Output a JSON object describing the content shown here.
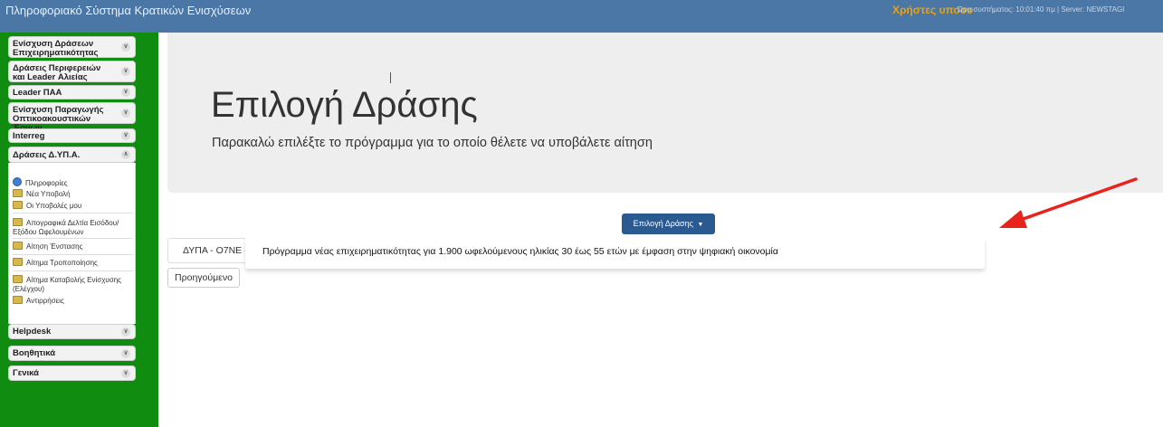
{
  "topbar": {
    "title": "Πληροφοριακό Σύστημα Κρατικών Ενισχύσεων",
    "user": "Χρήστες υποου",
    "system_time": "Ώρα συστήματος: 10:01:40 πμ | Server: NEWSTAGI"
  },
  "sidebar": {
    "sections": [
      {
        "label": "Ενίσχυση Δράσεων Επιχειρηματικότητας"
      },
      {
        "label": "Δράσεις Περιφερειών και Leader Αλιείας"
      },
      {
        "label": "Leader ΠΑΑ"
      },
      {
        "label": "Ενίσχυση Παραγωγής Οπτικοακουστικών Έργων"
      },
      {
        "label": "Interreg"
      },
      {
        "label": "Δράσεις Δ.ΥΠ.Α."
      },
      {
        "label": "Helpdesk"
      },
      {
        "label": "Βοηθητικά"
      },
      {
        "label": "Γενικά"
      }
    ],
    "expanded_items": [
      {
        "label": "Πληροφορίες"
      },
      {
        "label": "Νέα Υποβολή"
      },
      {
        "label": "Οι Υποβολές μου"
      },
      {
        "label": "Απογραφικά Δελτία Εισόδου/Εξόδου Ωφελουμένων"
      },
      {
        "label": "Αίτηση Ένστασης"
      },
      {
        "label": "Αίτημα Τροποποίησης"
      },
      {
        "label": "Αίτημα Καταβολής Ενίσχυσης (Ελέγχου)"
      },
      {
        "label": "Αντιρρήσεις"
      }
    ]
  },
  "main": {
    "title": "Επιλογή Δράσης",
    "subtitle": "Παρακαλώ επιλέξτε το πρόγραμμα για το οποίο θέλετε να υποβάλετε αίτηση",
    "dropdown_label": "Επιλογή Δράσης",
    "tab_label": "ΔΥΠΑ - Ο7ΝΕ -",
    "dropdown_option": "Πρόγραμμα νέας επιχειρηματικότητας για 1.900 ωφελούμενους ηλικίας 30 έως 55 ετών με έμφαση στην ψηφιακή οικονομία",
    "prev_button": "Προηγούμενο"
  },
  "colors": {
    "topbar": "#4a77a6",
    "sidebar": "#108c10",
    "primary_button": "#2a5a90",
    "arrow": "#e8231c",
    "user_link": "#f2a200"
  }
}
